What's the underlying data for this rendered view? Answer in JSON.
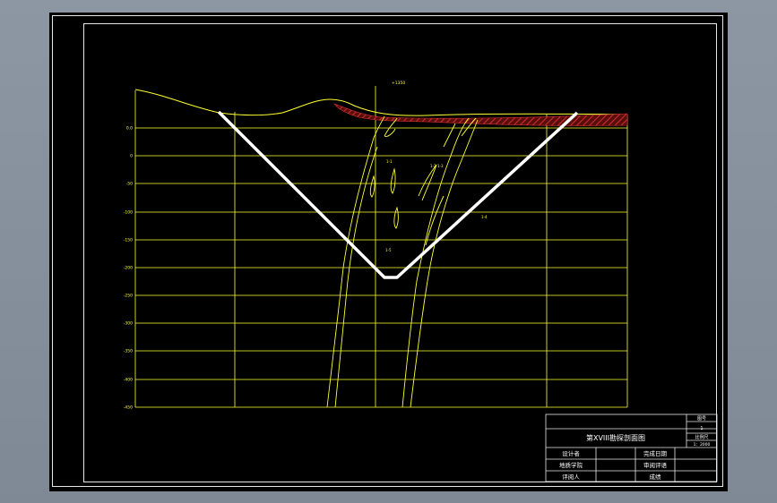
{
  "drawing": {
    "top_label": "+1350",
    "depth_labels": [
      "0.0",
      "0",
      "-50",
      "-100",
      "-150",
      "-200",
      "-250",
      "-300",
      "-350",
      "-400",
      "-450"
    ],
    "ore_notes": [
      "1-1",
      "1-2",
      "1-3",
      "1-4",
      "1-5"
    ]
  },
  "title_block": {
    "drawing_number_label": "图号",
    "drawing_number_value": "1",
    "title": "第XVIII勘探剖面图",
    "scale_label": "比例尺",
    "scale_value": "1：2000",
    "rows": [
      {
        "label_left": "设计者",
        "label_right": "完成日期"
      },
      {
        "label_left": "地质学院",
        "label_right": "审阅评语"
      },
      {
        "label_left": "评阅人",
        "label_right": "成绩"
      }
    ]
  },
  "colors": {
    "background": "#000000",
    "grid": "#ffff33",
    "frame": "#e6e6e6",
    "pit_outline": "#ffffff",
    "hatch": "#b02020"
  }
}
